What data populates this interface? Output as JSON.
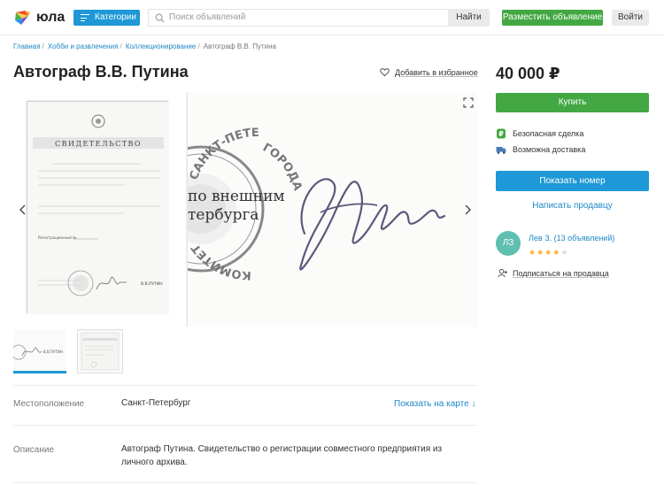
{
  "header": {
    "logo_text": "юла",
    "categories_label": "Категории",
    "search_placeholder": "Поиск объявлений",
    "search_button": "Найти",
    "post_button": "Разместить объявление",
    "login_button": "Войти"
  },
  "breadcrumb": [
    "Главная",
    "Хобби и развлечения",
    "Коллекционирование",
    "Автограф В.В. Путина"
  ],
  "listing": {
    "title": "Автограф В.В. Путина",
    "favorite_label": "Добавить в избранное",
    "location_label": "Местоположение",
    "location_value": "Санкт-Петербург",
    "map_link": "Показать на карте ↓",
    "description_label": "Описание",
    "description_value": "Автограф Путина. Свидетельство о регистрации совместного предприятия из личного архива."
  },
  "document": {
    "header": "СВИДЕТЕЛЬСТВО",
    "seal_text_1": "по внешним",
    "seal_text_2": "тербурга",
    "arc_top": "САНКТ-ПЕТЕРБУРГ",
    "arc_right": "ГОРОДА",
    "arc_bottom": "КОМИТЕТ",
    "signer": "В.В.ПУТИН",
    "reg_label": "Регистрационный №"
  },
  "sidebar": {
    "price": "40 000 ₽",
    "buy_button": "Купить",
    "features": [
      {
        "icon": "shield-ruble-icon",
        "label": "Безопасная сделка"
      },
      {
        "icon": "truck-icon",
        "label": "Возможна доставка"
      }
    ],
    "phone_button": "Показать номер",
    "write_link": "Написать продавцу",
    "seller": {
      "initials": "ЛЗ",
      "name": "Лев З. (13 объявлений)",
      "rating": 4,
      "rating_max": 5
    },
    "subscribe_label": "Подписаться на продавца"
  },
  "colors": {
    "blue": "#1e98d7",
    "green": "#43a843",
    "link": "#1e88c7",
    "avatar": "#5fbfb0",
    "star": "#f5b323"
  }
}
